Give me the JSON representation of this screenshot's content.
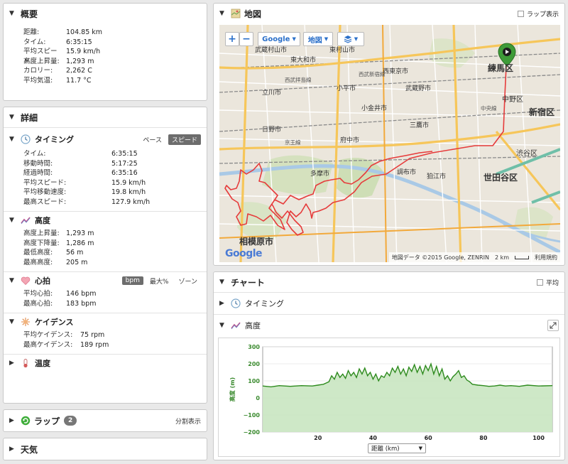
{
  "summary": {
    "title": "概要",
    "rows": [
      {
        "k": "距離:",
        "v": "104.85 km"
      },
      {
        "k": "タイム:",
        "v": "6:35:15"
      },
      {
        "k": "平均スピード:",
        "v": "15.9 km/h"
      },
      {
        "k": "高度上昇量:",
        "v": "1,293 m"
      },
      {
        "k": "カロリー:",
        "v": "2,262 C"
      },
      {
        "k": "平均気温:",
        "v": "11.7 °C"
      }
    ]
  },
  "details": {
    "title": "詳細",
    "timing": {
      "title": "タイミング",
      "pace_label": "ペース",
      "speed_label": "スピード",
      "rows": [
        {
          "k": "タイム:",
          "v": "6:35:15"
        },
        {
          "k": "移動時間:",
          "v": "5:17:25"
        },
        {
          "k": "経過時間:",
          "v": "6:35:16"
        },
        {
          "k": "平均スピード:",
          "v": "15.9 km/h"
        },
        {
          "k": "平均移動速度:",
          "v": "19.8 km/h"
        },
        {
          "k": "最高スピード:",
          "v": "127.9 km/h"
        }
      ]
    },
    "elevation": {
      "title": "高度",
      "rows": [
        {
          "k": "高度上昇量:",
          "v": "1,293 m"
        },
        {
          "k": "高度下降量:",
          "v": "1,286 m"
        },
        {
          "k": "最低高度:",
          "v": "56 m"
        },
        {
          "k": "最高高度:",
          "v": "205 m"
        }
      ]
    },
    "heart": {
      "title": "心拍",
      "bpm_label": "bpm",
      "max_label": "最大%",
      "zone_label": "ゾーン",
      "rows": [
        {
          "k": "平均心拍:",
          "v": "146 bpm"
        },
        {
          "k": "最高心拍:",
          "v": "183 bpm"
        }
      ]
    },
    "cadence": {
      "title": "ケイデンス",
      "rows": [
        {
          "k": "平均ケイデンス:",
          "v": "75 rpm"
        },
        {
          "k": "最高ケイデンス:",
          "v": "189 rpm"
        }
      ]
    },
    "temp": {
      "title": "温度"
    }
  },
  "laps": {
    "title": "ラップ",
    "count": "2",
    "split_label": "分割表示"
  },
  "weather": {
    "title": "天気"
  },
  "map": {
    "title": "地図",
    "lap_label": "ラップ表示",
    "zoom_in": "+",
    "zoom_out": "−",
    "google_btn": "Google",
    "map_btn": "地図",
    "attribution": "地図データ ©2015 Google, ZENRIN",
    "scale": "2 km",
    "terms": "利用規約",
    "logo": "Google",
    "places": [
      {
        "t": "武蔵村山市"
      },
      {
        "t": "東大和市"
      },
      {
        "t": "東村山市"
      },
      {
        "t": "西東京市"
      },
      {
        "t": "練馬区"
      },
      {
        "t": "立川市"
      },
      {
        "t": "小平市"
      },
      {
        "t": "武蔵野市"
      },
      {
        "t": "中野区"
      },
      {
        "t": "小金井市"
      },
      {
        "t": "新宿区"
      },
      {
        "t": "三鷹市"
      },
      {
        "t": "府中市"
      },
      {
        "t": "調布市"
      },
      {
        "t": "渋谷区"
      },
      {
        "t": "多摩市"
      },
      {
        "t": "狛江市"
      },
      {
        "t": "世田谷区"
      },
      {
        "t": "相模原市"
      },
      {
        "t": "日野市"
      },
      {
        "t": "中央線"
      },
      {
        "t": "西武拝島線"
      },
      {
        "t": "西武新宿線"
      },
      {
        "t": "京王線"
      }
    ]
  },
  "chart": {
    "title": "チャート",
    "avg_label": "平均",
    "timing_label": "タイミング",
    "elevation_label": "高度",
    "dist_select": "距離 (km)"
  },
  "chart_data": {
    "type": "area",
    "ylabel": "高度 (m)",
    "xlabel": "距離 (km)",
    "xlim": [
      0,
      105
    ],
    "ylim": [
      -200,
      300
    ],
    "yticks": [
      "300",
      "200",
      "100",
      "0",
      "−100",
      "−200"
    ],
    "xticks": [
      "20",
      "40",
      "60",
      "80",
      "100"
    ],
    "series": [
      {
        "color": "#2e8b1e",
        "x": [
          0,
          3,
          6,
          10,
          14,
          18,
          20,
          22,
          24,
          25,
          26,
          27,
          28,
          29,
          30,
          31,
          32,
          33,
          34,
          35,
          36,
          37,
          38,
          39,
          40,
          41,
          42,
          43,
          44,
          45,
          46,
          47,
          48,
          49,
          50,
          51,
          52,
          53,
          54,
          55,
          56,
          57,
          58,
          59,
          60,
          61,
          62,
          63,
          64,
          65,
          66,
          67,
          68,
          69,
          70,
          71,
          72,
          73,
          74,
          75,
          76,
          78,
          80,
          82,
          84,
          86,
          88,
          90,
          93,
          96,
          100,
          105
        ],
        "values": [
          70,
          65,
          72,
          68,
          72,
          70,
          75,
          80,
          95,
          130,
          110,
          150,
          120,
          140,
          115,
          160,
          130,
          150,
          120,
          170,
          140,
          175,
          130,
          150,
          110,
          140,
          100,
          130,
          120,
          150,
          130,
          175,
          150,
          185,
          140,
          170,
          130,
          180,
          155,
          195,
          150,
          185,
          140,
          190,
          160,
          200,
          140,
          185,
          130,
          170,
          110,
          130,
          100,
          125,
          140,
          160,
          120,
          130,
          105,
          95,
          80,
          75,
          72,
          68,
          70,
          75,
          70,
          72,
          68,
          75,
          70,
          72
        ]
      }
    ]
  }
}
